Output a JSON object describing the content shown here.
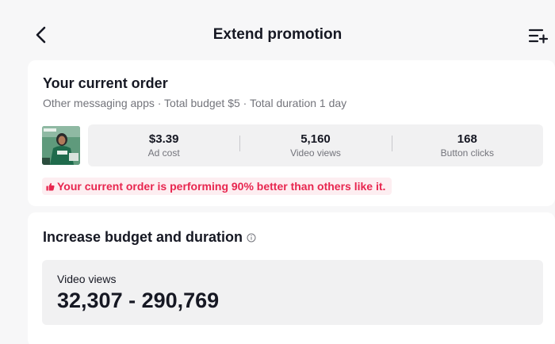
{
  "header": {
    "title": "Extend promotion",
    "back_icon": "chevron-left-icon",
    "menu_icon": "list-add-icon"
  },
  "current_order": {
    "title": "Your current order",
    "subtitle": "Other messaging apps · Total budget $5 · Total duration 1 day",
    "stats": [
      {
        "value": "$3.39",
        "label": "Ad cost"
      },
      {
        "value": "5,160",
        "label": "Video views"
      },
      {
        "value": "168",
        "label": "Button clicks"
      }
    ],
    "performance_text": "Your current order is performing 90% better than others like it.",
    "performance_icon": "thumbs-up-icon"
  },
  "increase": {
    "title": "Increase budget and duration",
    "info_icon": "info-icon",
    "views_label": "Video views",
    "views_value": "32,307 - 290,769"
  },
  "colors": {
    "background": "#f7f7f8",
    "card": "#ffffff",
    "accent_red": "#e8264f",
    "badge_bg": "#fdeef1",
    "muted_text": "#73747b"
  }
}
